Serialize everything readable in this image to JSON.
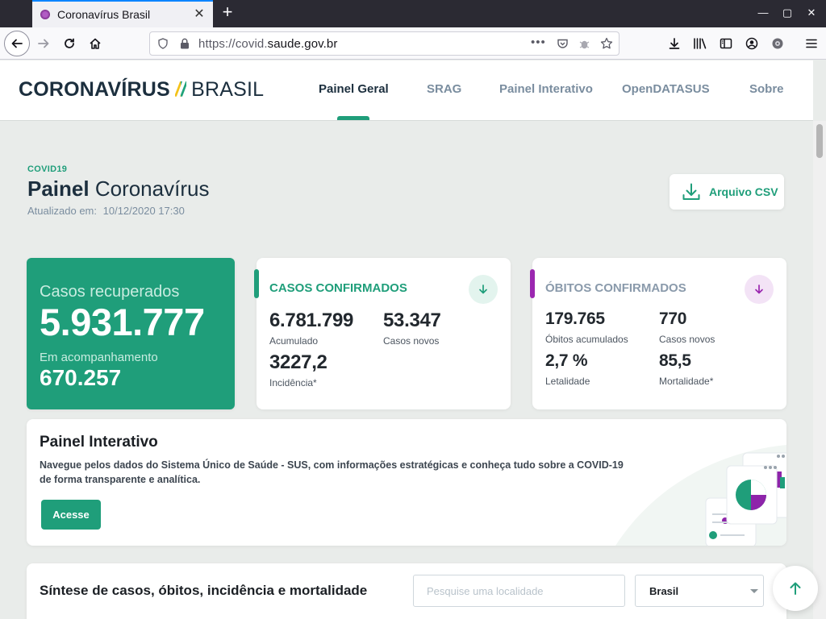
{
  "browser": {
    "tab_title": "Coronavírus Brasil",
    "url_prefix": "https://covid.",
    "url_domain": "saude.gov.br"
  },
  "header": {
    "logo_bold": "CORONAVÍRUS",
    "logo_slash": "//",
    "logo_light": "BRASIL",
    "menu": [
      {
        "label": "Painel Geral",
        "active": true
      },
      {
        "label": "SRAG"
      },
      {
        "label": "Painel Interativo"
      },
      {
        "label": "OpenDATASUS"
      },
      {
        "label": "Sobre"
      }
    ]
  },
  "page": {
    "kicker": "COVID19",
    "title_bold": "Painel",
    "title_rest": "Coronavírus",
    "updated_label": "Atualizado em:",
    "updated_value": "10/12/2020 17:30",
    "csv_label": "Arquivo CSV"
  },
  "recovered": {
    "label": "Casos recuperados",
    "value": "5.931.777",
    "followup_label": "Em acompanhamento",
    "followup_value": "670.257"
  },
  "cases": {
    "title": "CASOS CONFIRMADOS",
    "accent": "#1f9e7a",
    "acumulado_value": "6.781.799",
    "acumulado_label": "Acumulado",
    "novos_value": "53.347",
    "novos_label": "Casos novos",
    "incidencia_value": "3227,2",
    "incidencia_label": "Incidência*"
  },
  "deaths": {
    "title": "ÓBITOS CONFIRMADOS",
    "accent": "#9b27b0",
    "acumulados_value": "179.765",
    "acumulados_label": "Óbitos acumulados",
    "novos_value": "770",
    "novos_label": "Casos novos",
    "letalidade_value": "2,7 %",
    "letalidade_label": "Letalidade",
    "mortalidade_value": "85,5",
    "mortalidade_label": "Mortalidade*"
  },
  "panel": {
    "title": "Painel Interativo",
    "description": "Navegue pelos dados do Sistema Único de Saúde - SUS, com informações estratégicas e conheça tudo sobre a COVID-19 de forma transparente e analítica.",
    "button": "Acesse"
  },
  "synthesis": {
    "title": "Síntese de casos, óbitos, incidência e mortalidade",
    "search_placeholder": "Pesquise uma localidade",
    "region_value": "Brasil"
  }
}
